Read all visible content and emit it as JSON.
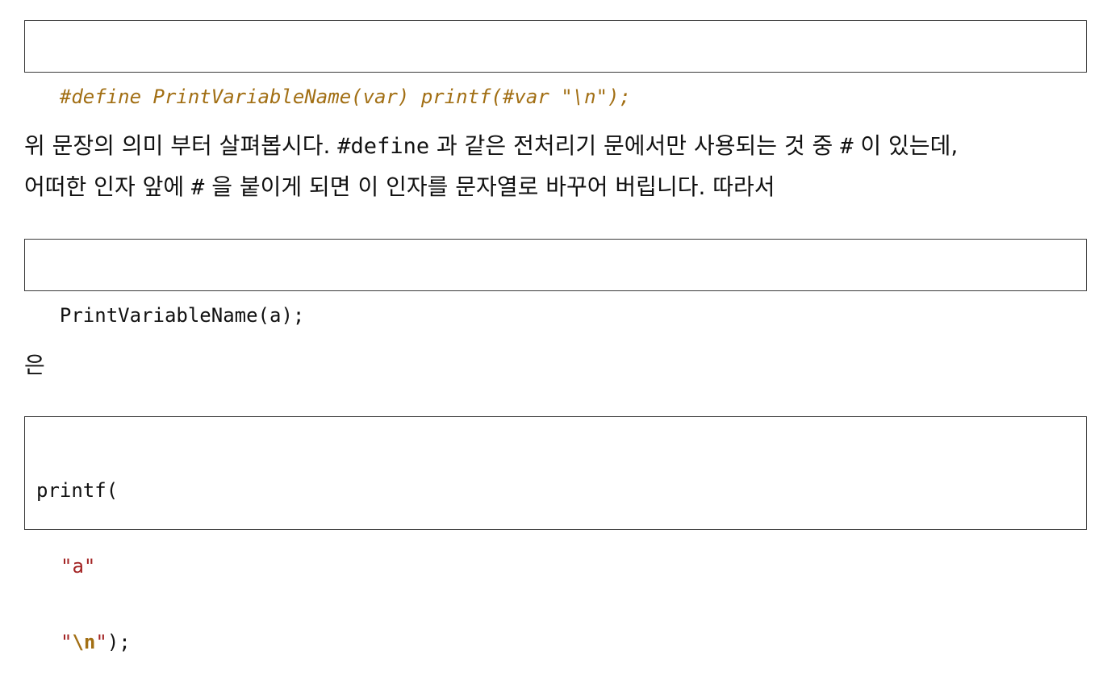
{
  "code_block_1": {
    "text": "#define PrintVariableName(var) printf(#var \"\\n\");"
  },
  "paragraph_1": {
    "line1_part1": "위 문장의 의미 부터 살펴봅시다. ",
    "line1_code": "#define",
    "line1_part2": " 과 같은 전처리기 문에서만 사용되는 것 중 ",
    "line1_hash": "#",
    "line1_part3": " 이 있는데,",
    "line2_part1": "어떠한 인자 앞에 ",
    "line2_hash": "#",
    "line2_part2": " 을 붙이게 되면 이 인자를 문자열로 바꾸어 버립니다. 따라서"
  },
  "code_block_2": {
    "text": "PrintVariableName(a);"
  },
  "paragraph_2": {
    "text": "은"
  },
  "code_block_3": {
    "line1": "printf(",
    "line2": "\"a\"",
    "line3_quote_open": "\"",
    "line3_escape": "\\n",
    "line3_quote_close": "\"",
    "line3_rest": ");"
  }
}
